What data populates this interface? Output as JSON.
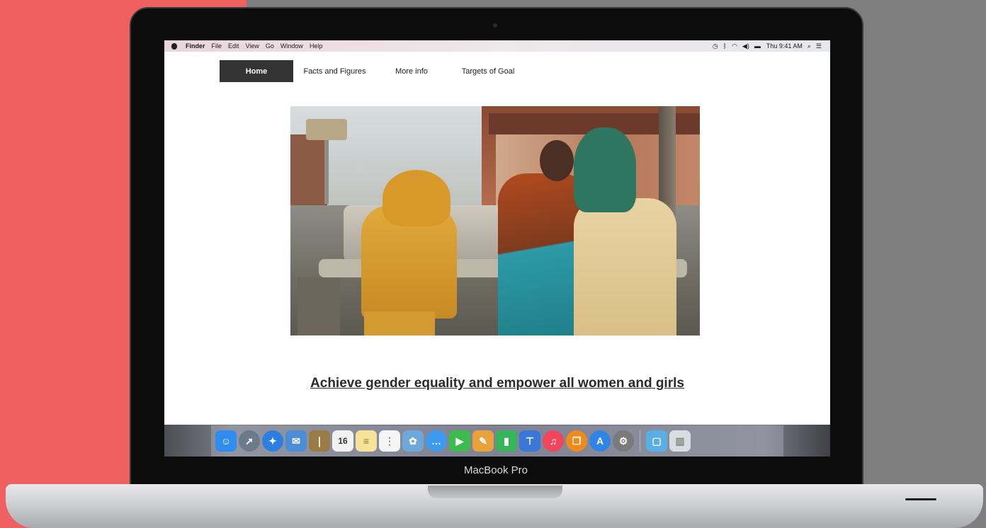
{
  "device": {
    "model_label": "MacBook Pro"
  },
  "menubar": {
    "apple_icon": "apple-icon",
    "items": [
      "Finder",
      "File",
      "Edit",
      "View",
      "Go",
      "Window",
      "Help"
    ],
    "status_icons": [
      "time-machine-icon",
      "bluetooth-icon",
      "wifi-icon",
      "volume-icon",
      "battery-icon"
    ],
    "clock": "Thu 9:41 AM",
    "search_icon": "spotlight-search-icon",
    "list_icon": "notification-center-icon"
  },
  "site_nav": {
    "items": [
      {
        "label": "Home",
        "active": true
      },
      {
        "label": "Facts and Figures",
        "active": false
      },
      {
        "label": "More info",
        "active": false
      },
      {
        "label": "Targets of Goal",
        "active": false
      }
    ]
  },
  "hero": {
    "image_icon": "hero-photo"
  },
  "headline": "Achieve gender equality and empower all women and girls",
  "dock": {
    "calendar_day": "16",
    "apps": [
      {
        "icon": "finder-icon",
        "color": "#2f8cf0"
      },
      {
        "icon": "launchpad-icon",
        "color": "#6b7b8c"
      },
      {
        "icon": "safari-icon",
        "color": "#2b7fe0"
      },
      {
        "icon": "mail-icon",
        "color": "#4b8dd6"
      },
      {
        "icon": "contacts-icon",
        "color": "#9a7a45"
      },
      {
        "icon": "calendar-icon",
        "color": "#f2f2f2"
      },
      {
        "icon": "notes-icon",
        "color": "#f6e39a"
      },
      {
        "icon": "reminders-icon",
        "color": "#f5f5f5"
      },
      {
        "icon": "photos-icon",
        "color": "#6ea8d8"
      },
      {
        "icon": "messages-icon",
        "color": "#3c9bf1"
      },
      {
        "icon": "facetime-icon",
        "color": "#3dbb4e"
      },
      {
        "icon": "pages-icon",
        "color": "#e9a13b"
      },
      {
        "icon": "numbers-icon",
        "color": "#36b45a"
      },
      {
        "icon": "keynote-icon",
        "color": "#3a78d8"
      },
      {
        "icon": "itunes-icon",
        "color": "#f2455c"
      },
      {
        "icon": "ibooks-icon",
        "color": "#f08a1c"
      },
      {
        "icon": "app-store-icon",
        "color": "#2f84e8"
      },
      {
        "icon": "system-preferences-icon",
        "color": "#7a7a7a"
      }
    ],
    "extras": [
      {
        "icon": "downloads-folder-icon",
        "color": "#5aaee8"
      },
      {
        "icon": "trash-icon",
        "color": "#d8dde2"
      }
    ]
  }
}
